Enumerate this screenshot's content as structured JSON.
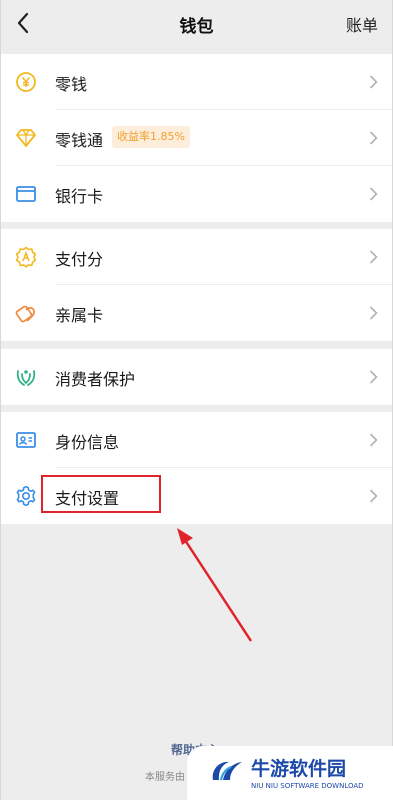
{
  "header": {
    "title": "钱包",
    "bill_label": "账单"
  },
  "section1": [
    {
      "label": "零钱",
      "icon": "coin-icon"
    },
    {
      "label": "零钱通",
      "icon": "diamond-icon",
      "badge": "收益率1.85%"
    },
    {
      "label": "银行卡",
      "icon": "card-icon"
    }
  ],
  "section2": [
    {
      "label": "支付分",
      "icon": "score-icon"
    },
    {
      "label": "亲属卡",
      "icon": "family-card-icon"
    }
  ],
  "section3": [
    {
      "label": "消费者保护",
      "icon": "protect-icon"
    }
  ],
  "section4": [
    {
      "label": "身份信息",
      "icon": "id-icon"
    },
    {
      "label": "支付设置",
      "icon": "gear-icon"
    }
  ],
  "footer": {
    "help": "帮助中心",
    "service": "本服务由"
  },
  "watermark": {
    "title": "牛游软件园",
    "subtitle": "NIU NIU SOFTWARE DOWNLOAD"
  },
  "colors": {
    "background": "#ededed",
    "highlight": "#e0242a",
    "badge_text": "#f0a030",
    "link": "#576b95"
  }
}
